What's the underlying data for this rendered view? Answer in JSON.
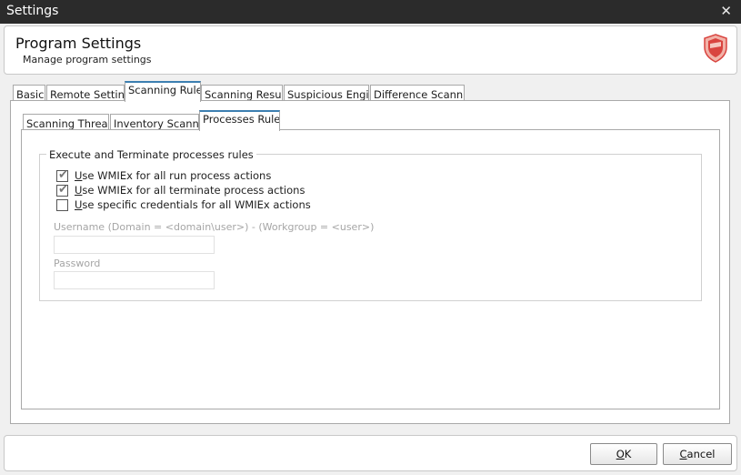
{
  "window": {
    "title": "Settings",
    "close_glyph": "✕"
  },
  "header": {
    "title": "Program Settings",
    "subtitle": "Manage program settings",
    "icon": "shield-icon",
    "icon_color": "#d9443f"
  },
  "tabs": [
    {
      "label": "Basic"
    },
    {
      "label": "Remote Settings"
    },
    {
      "label": "Scanning Rules",
      "active": true
    },
    {
      "label": "Scanning Results"
    },
    {
      "label": "Suspicious Engine"
    },
    {
      "label": "Difference Scanning"
    }
  ],
  "subtabs": [
    {
      "label": "Scanning Threads"
    },
    {
      "label": "Inventory Scanning"
    },
    {
      "label": "Processes Rules",
      "active": true
    }
  ],
  "group": {
    "title": "Execute and Terminate processes rules",
    "options": [
      {
        "label_key": "U",
        "label_rest": "se WMIEx for all run process actions",
        "checked": true
      },
      {
        "label_key": "U",
        "label_rest": "se WMIEx for all terminate process actions",
        "checked": true
      },
      {
        "label_key": "U",
        "label_rest": "se specific credentials for all WMIEx actions",
        "checked": false
      }
    ],
    "username_label": "Username (Domain = <domain\\user>) - (Workgroup = <user>)",
    "username_value": "",
    "password_label": "Password",
    "password_value": ""
  },
  "footer": {
    "ok_key": "O",
    "ok_rest": "K",
    "cancel_key": "C",
    "cancel_rest": "ancel"
  },
  "colors": {
    "active_tab_accent": "#3c7fb1",
    "titlebar": "#2b2b2b"
  }
}
